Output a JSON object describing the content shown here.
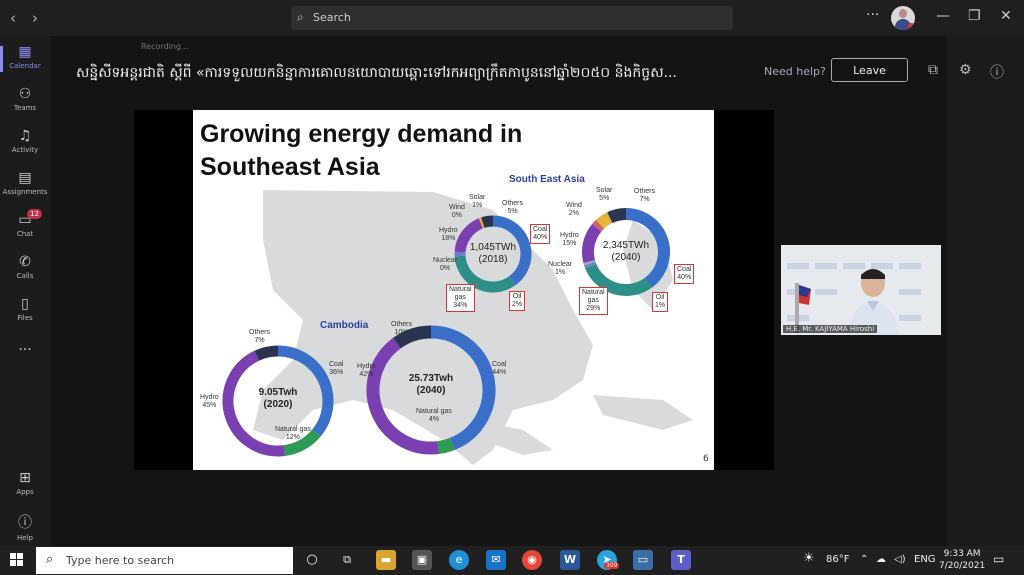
{
  "titlebar": {
    "search_placeholder": "Search"
  },
  "rail": [
    {
      "label": "Calendar",
      "icon": "calendar-icon"
    },
    {
      "label": "Teams",
      "icon": "teams-icon"
    },
    {
      "label": "Activity",
      "icon": "bell-icon"
    },
    {
      "label": "Assignments",
      "icon": "assignment-icon"
    },
    {
      "label": "Chat",
      "icon": "chat-icon",
      "badge": "12"
    },
    {
      "label": "Calls",
      "icon": "phone-icon"
    },
    {
      "label": "Files",
      "icon": "file-icon"
    },
    {
      "label": "Apps",
      "icon": "apps-icon"
    },
    {
      "label": "Help",
      "icon": "help-icon"
    }
  ],
  "meeting": {
    "title": "សន្និសីទអន្តរជាតិ ស្តីពី «ការទទួលយកនិន្នាការគោលនយោបាយឆ្ពោះទៅរកអព្យាក្រឹតកាបូននៅឆ្នាំ២០៥០ និងកិច្ចស...",
    "recording": "Recording...",
    "help": "Need help?",
    "leave": "Leave"
  },
  "slide": {
    "title_line1": "Growing energy demand in",
    "title_line2": "Southeast Asia",
    "page": "6",
    "sea_label": "South East Asia",
    "cam_label": "Cambodia",
    "sea2018": {
      "center1": "1,045TWh",
      "center2": "(2018)",
      "solar": "Solar",
      "solar_v": "1%",
      "wind": "Wind",
      "wind_v": "0%",
      "others": "Others",
      "others_v": "5%",
      "hydro": "Hydro",
      "hydro_v": "18%",
      "nuclear": "Nuclear",
      "nuclear_v": "0%",
      "coal": "Coal",
      "coal_v": "40%",
      "gas1": "Natural",
      "gas2": "gas",
      "gas_v": "34%",
      "oil": "Oil",
      "oil_v": "2%"
    },
    "sea2040": {
      "center1": "2,345TWh",
      "center2": "(2040)",
      "solar": "Solar",
      "solar_v": "5%",
      "others": "Others",
      "others_v": "7%",
      "wind": "Wind",
      "wind_v": "2%",
      "hydro": "Hydro",
      "hydro_v": "15%",
      "nuclear": "Nuclear",
      "nuclear_v": "1%",
      "coal": "Coal",
      "coal_v": "40%",
      "gas1": "Natural",
      "gas2": "gas",
      "gas_v": "29%",
      "oil": "Oil",
      "oil_v": "1%"
    },
    "cam2020": {
      "center1": "9.05Twh",
      "center2": "(2020)",
      "others": "Others",
      "others_v": "7%",
      "coal": "Coal",
      "coal_v": "36%",
      "hydro": "Hydro",
      "hydro_v": "45%",
      "gas": "Natural gas",
      "gas_v": "12%"
    },
    "cam2040": {
      "center1": "25.73Twh",
      "center2": "(2040)",
      "others": "Others",
      "others_v": "10%",
      "coal": "Coal",
      "coal_v": "44%",
      "hydro": "Hydro",
      "hydro_v": "42%",
      "gas": "Natural gas",
      "gas_v": "4%"
    }
  },
  "participant": {
    "name": "H.E. Mr. KAJIYAMA Hiroshi"
  },
  "taskbar": {
    "search_placeholder": "Type here to search",
    "weather": "86°F",
    "lang": "ENG",
    "time": "9:33 AM",
    "date": "7/20/2021",
    "telegram_badge": "309"
  },
  "colors": {
    "coal": "#3a6fc8",
    "gas": "#2d8f88",
    "hydro": "#7a3fb0",
    "others": "#2a3350",
    "oil": "#6a7fd0",
    "gas_cam": "#2e9a55",
    "accent": "#8b8cf0"
  },
  "chart_data": [
    {
      "type": "pie",
      "title": "South East Asia 2018",
      "total": "1,045TWh",
      "categories": [
        "Coal",
        "Natural gas",
        "Oil",
        "Nuclear",
        "Hydro",
        "Wind",
        "Solar",
        "Others"
      ],
      "values": [
        40,
        34,
        2,
        0,
        18,
        0,
        1,
        5
      ]
    },
    {
      "type": "pie",
      "title": "South East Asia 2040",
      "total": "2,345TWh",
      "categories": [
        "Coal",
        "Natural gas",
        "Oil",
        "Nuclear",
        "Hydro",
        "Wind",
        "Solar",
        "Others"
      ],
      "values": [
        40,
        29,
        1,
        1,
        15,
        2,
        5,
        7
      ]
    },
    {
      "type": "pie",
      "title": "Cambodia 2020",
      "total": "9.05Twh",
      "categories": [
        "Coal",
        "Natural gas",
        "Hydro",
        "Others"
      ],
      "values": [
        36,
        12,
        45,
        7
      ]
    },
    {
      "type": "pie",
      "title": "Cambodia 2040",
      "total": "25.73Twh",
      "categories": [
        "Coal",
        "Natural gas",
        "Hydro",
        "Others"
      ],
      "values": [
        44,
        4,
        42,
        10
      ]
    }
  ]
}
